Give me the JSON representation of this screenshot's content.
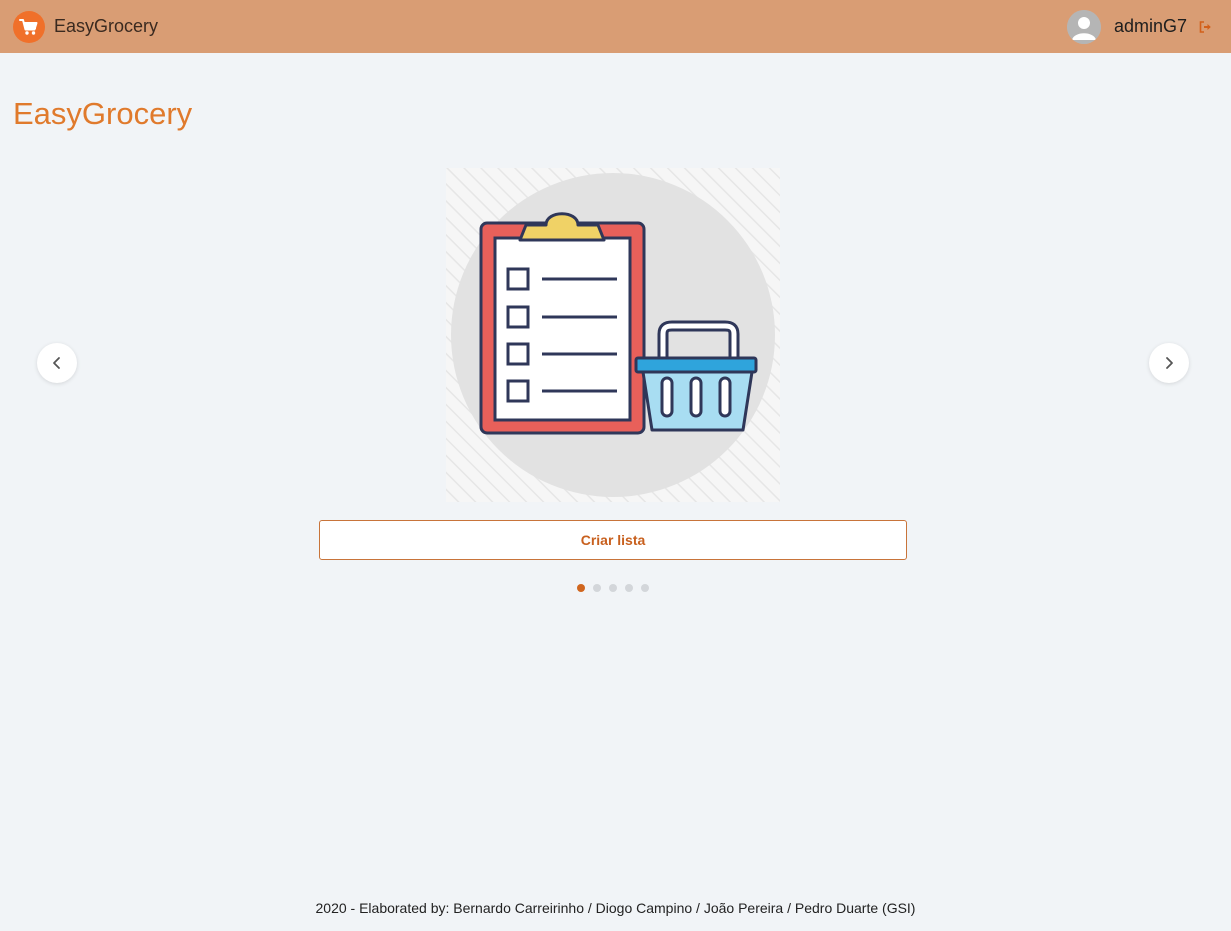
{
  "header": {
    "brand_name": "EasyGrocery",
    "username": "adminG7"
  },
  "main": {
    "title": "EasyGrocery",
    "carousel": {
      "button_label": "Criar lista",
      "slide_count": 5,
      "active_slide": 1
    }
  },
  "footer": {
    "text": "2020 - Elaborated by: Bernardo Carreirinho / Diogo Campino / João Pereira / Pedro Duarte (GSI)"
  },
  "colors": {
    "navbar": "#d99d74",
    "accent": "#e07a2c",
    "brand_logo": "#f0702a",
    "background": "#f1f4f7"
  },
  "icons": {
    "brand": "shopping-cart-icon",
    "avatar": "user-avatar-icon",
    "logout": "sign-out-icon",
    "prev": "chevron-left-icon",
    "next": "chevron-right-icon",
    "slide": "clipboard-checklist-basket-illustration"
  }
}
